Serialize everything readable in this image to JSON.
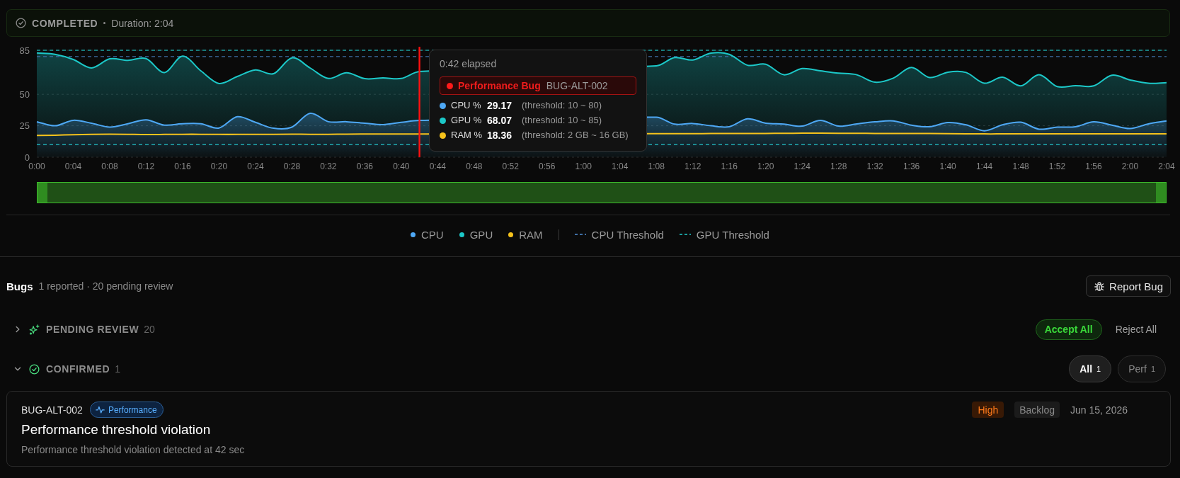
{
  "status": {
    "label": "COMPLETED",
    "detail": "Duration: 2:04"
  },
  "chart": {
    "chart_data": {
      "type": "area",
      "x": [
        0,
        2,
        4,
        6,
        8,
        10,
        12,
        14,
        16,
        18,
        20,
        22,
        24,
        26,
        28,
        30,
        32,
        34,
        36,
        38,
        40,
        42,
        68,
        70,
        72,
        74,
        76,
        78,
        80,
        82,
        84,
        86,
        88,
        90,
        92,
        94,
        96,
        98,
        100,
        102,
        104,
        106,
        108,
        110,
        112,
        114,
        116,
        118,
        120,
        122,
        124
      ],
      "series": [
        {
          "name": "CPU",
          "color": "#4ea8f5",
          "values": [
            28.2,
            25.0,
            29.3,
            27.0,
            23.9,
            26.6,
            29.7,
            25.5,
            26.6,
            26.6,
            23.2,
            32.2,
            27.7,
            23.0,
            23.9,
            34.9,
            28.2,
            28.2,
            27.0,
            25.9,
            27.7,
            29.2,
            31.8,
            26.3,
            26.8,
            25.0,
            24.2,
            30.5,
            27.1,
            26.3,
            24.7,
            29.2,
            24.7,
            26.5,
            28.1,
            28.9,
            25.5,
            24.2,
            27.6,
            25.7,
            21.0,
            25.7,
            27.8,
            22.3,
            23.9,
            24.2,
            28.1,
            25.5,
            22.8,
            26.5,
            28.9
          ]
        },
        {
          "name": "GPU",
          "color": "#1cc8c8",
          "values": [
            82.9,
            81.8,
            77.7,
            70.9,
            78.2,
            77.0,
            78.4,
            67.3,
            80.4,
            68.7,
            58.6,
            64.2,
            69.4,
            66.4,
            79.0,
            70.9,
            62.6,
            67.1,
            62.4,
            63.0,
            62.6,
            68.1,
            72.6,
            79.2,
            77.3,
            82.7,
            81.8,
            73.1,
            73.9,
            65.5,
            70.5,
            68.6,
            66.8,
            65.5,
            59.6,
            62.8,
            71.3,
            63.3,
            67.6,
            67.3,
            58.8,
            63.6,
            56.7,
            65.5,
            56.2,
            56.9,
            56.7,
            65.2,
            61.4,
            58.8,
            59.3
          ]
        },
        {
          "name": "RAM",
          "type": "line",
          "color": "#f5c21b",
          "values": [
            17.3,
            17.5,
            17.9,
            18.2,
            18.3,
            18.2,
            18.0,
            18.1,
            18.2,
            18.2,
            18.1,
            18.1,
            18.2,
            18.2,
            18.3,
            18.2,
            18.2,
            18.3,
            18.4,
            18.4,
            18.4,
            18.4,
            18.7,
            18.7,
            18.7,
            18.8,
            18.8,
            18.9,
            18.9,
            19.0,
            19.1,
            19.1,
            19.0,
            19.0,
            18.9,
            18.8,
            18.8,
            18.8,
            18.7,
            18.6,
            18.5,
            18.5,
            18.5,
            18.5,
            18.5,
            18.5,
            18.5,
            18.5,
            18.5,
            18.5,
            18.5
          ]
        }
      ],
      "xlim": [
        0,
        124
      ],
      "ylim": [
        0,
        85
      ],
      "xticks": [
        {
          "value": 0,
          "label": "0:00"
        },
        {
          "value": 4,
          "label": "0:04"
        },
        {
          "value": 8,
          "label": "0:08"
        },
        {
          "value": 12,
          "label": "0:12"
        },
        {
          "value": 16,
          "label": "0:16"
        },
        {
          "value": 20,
          "label": "0:20"
        },
        {
          "value": 24,
          "label": "0:24"
        },
        {
          "value": 28,
          "label": "0:28"
        },
        {
          "value": 32,
          "label": "0:32"
        },
        {
          "value": 36,
          "label": "0:36"
        },
        {
          "value": 40,
          "label": "0:40"
        },
        {
          "value": 44,
          "label": "0:44"
        },
        {
          "value": 48,
          "label": "0:48"
        },
        {
          "value": 52,
          "label": "0:52"
        },
        {
          "value": 56,
          "label": "0:56"
        },
        {
          "value": 60,
          "label": "1:00"
        },
        {
          "value": 64,
          "label": "1:04"
        },
        {
          "value": 68,
          "label": "1:08"
        },
        {
          "value": 72,
          "label": "1:12"
        },
        {
          "value": 76,
          "label": "1:16"
        },
        {
          "value": 80,
          "label": "1:20"
        },
        {
          "value": 84,
          "label": "1:24"
        },
        {
          "value": 88,
          "label": "1:28"
        },
        {
          "value": 92,
          "label": "1:32"
        },
        {
          "value": 96,
          "label": "1:36"
        },
        {
          "value": 100,
          "label": "1:40"
        },
        {
          "value": 104,
          "label": "1:44"
        },
        {
          "value": 108,
          "label": "1:48"
        },
        {
          "value": 112,
          "label": "1:52"
        },
        {
          "value": 116,
          "label": "1:56"
        },
        {
          "value": 120,
          "label": "2:00"
        },
        {
          "value": 124,
          "label": "2:04"
        }
      ],
      "yticks": [
        0,
        25,
        50,
        85
      ],
      "ref_lines": [
        {
          "axis": "y",
          "value": 80,
          "color": "#3f6fa6"
        },
        {
          "axis": "y",
          "value": 10,
          "color": "#3f6fa6"
        },
        {
          "axis": "y",
          "value": 85,
          "color": "#1a9e9e"
        },
        {
          "axis": "y",
          "value": 10,
          "color": "#1a9e9e"
        },
        {
          "axis": "x",
          "value": 42,
          "color": "#ff1010"
        }
      ]
    },
    "threshold_legend": [
      {
        "label": "CPU Threshold",
        "color": "#3f6fa6"
      },
      {
        "label": "GPU Threshold",
        "color": "#1a9e9e"
      }
    ],
    "tooltip": {
      "elapsed": "0:42 elapsed",
      "bug_label": "Performance Bug",
      "bug_id": "BUG-ALT-002",
      "rows": [
        {
          "label": "CPU %",
          "value": "29.17",
          "threshold": "(threshold: 10 ~ 80)",
          "color": "#4ea8f5"
        },
        {
          "label": "GPU %",
          "value": "68.07",
          "threshold": "(threshold: 10 ~ 85)",
          "color": "#1cc8c8"
        },
        {
          "label": "RAM %",
          "value": "18.36",
          "threshold": "(threshold: 2 GB ~ 16 GB)",
          "color": "#f5c21b"
        }
      ]
    },
    "range_selector": {
      "level": 1
    }
  },
  "bugs": {
    "title": "Bugs",
    "summary": "1 reported · 20 pending review",
    "report_button": "Report Bug",
    "groups": [
      {
        "kind": "review",
        "label": "PENDING REVIEW",
        "count": "20",
        "expanded": false,
        "actions": [
          {
            "kind": "primary",
            "label": "Accept All"
          },
          {
            "kind": "plain",
            "label": "Reject All"
          }
        ]
      },
      {
        "kind": "confirmed",
        "label": "CONFIRMED",
        "count": "1",
        "expanded": true,
        "filters": [
          {
            "label": "All",
            "count": "1",
            "selected": true
          },
          {
            "label": "Perf",
            "count": "1",
            "selected": false
          }
        ],
        "items": [
          {
            "id": "BUG-ALT-002",
            "category": "Performance",
            "title": "Performance threshold violation",
            "description": "Performance threshold violation detected at 42 sec",
            "priority": "High",
            "status": "Backlog",
            "date": "Jun 15, 2026"
          }
        ]
      }
    ]
  }
}
